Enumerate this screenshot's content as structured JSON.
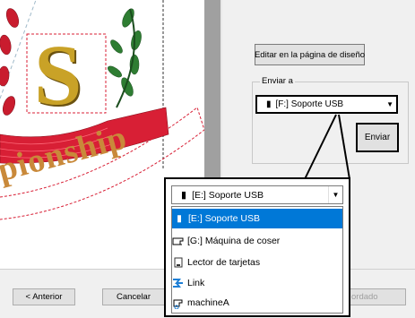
{
  "colors": {
    "accent_select": "#0078d7",
    "panel_gray": "#f0f0f0",
    "dark_gray": "#a0a0a0",
    "gold": "#c9a227",
    "red_stitch": "#d81f35",
    "green_stitch": "#2e7d32"
  },
  "design": {
    "letter": "S",
    "arc_text": "pionship"
  },
  "panel": {
    "edit_button": "Editar en la página de diseño",
    "send_group_label": "Enviar a",
    "selected_device": "[F:] Soporte USB",
    "send_button": "Enviar"
  },
  "footer": {
    "back_button": "< Anterior",
    "cancel_button": "Cancelar",
    "partial_button_text": "ordado"
  },
  "dropdown": {
    "current_value": "[E:] Soporte USB",
    "items": [
      {
        "label": "[E:] Soporte USB",
        "icon": "usb-drive-icon",
        "selected": true
      },
      {
        "label": "[G:] Máquina de coser",
        "icon": "sewing-machine-icon",
        "selected": false
      },
      {
        "label": "Lector de tarjetas",
        "icon": "card-reader-icon",
        "selected": false
      },
      {
        "label": "Link",
        "icon": "link-icon",
        "selected": false
      },
      {
        "label": "machineA",
        "icon": "network-machine-icon",
        "selected": false
      }
    ]
  }
}
